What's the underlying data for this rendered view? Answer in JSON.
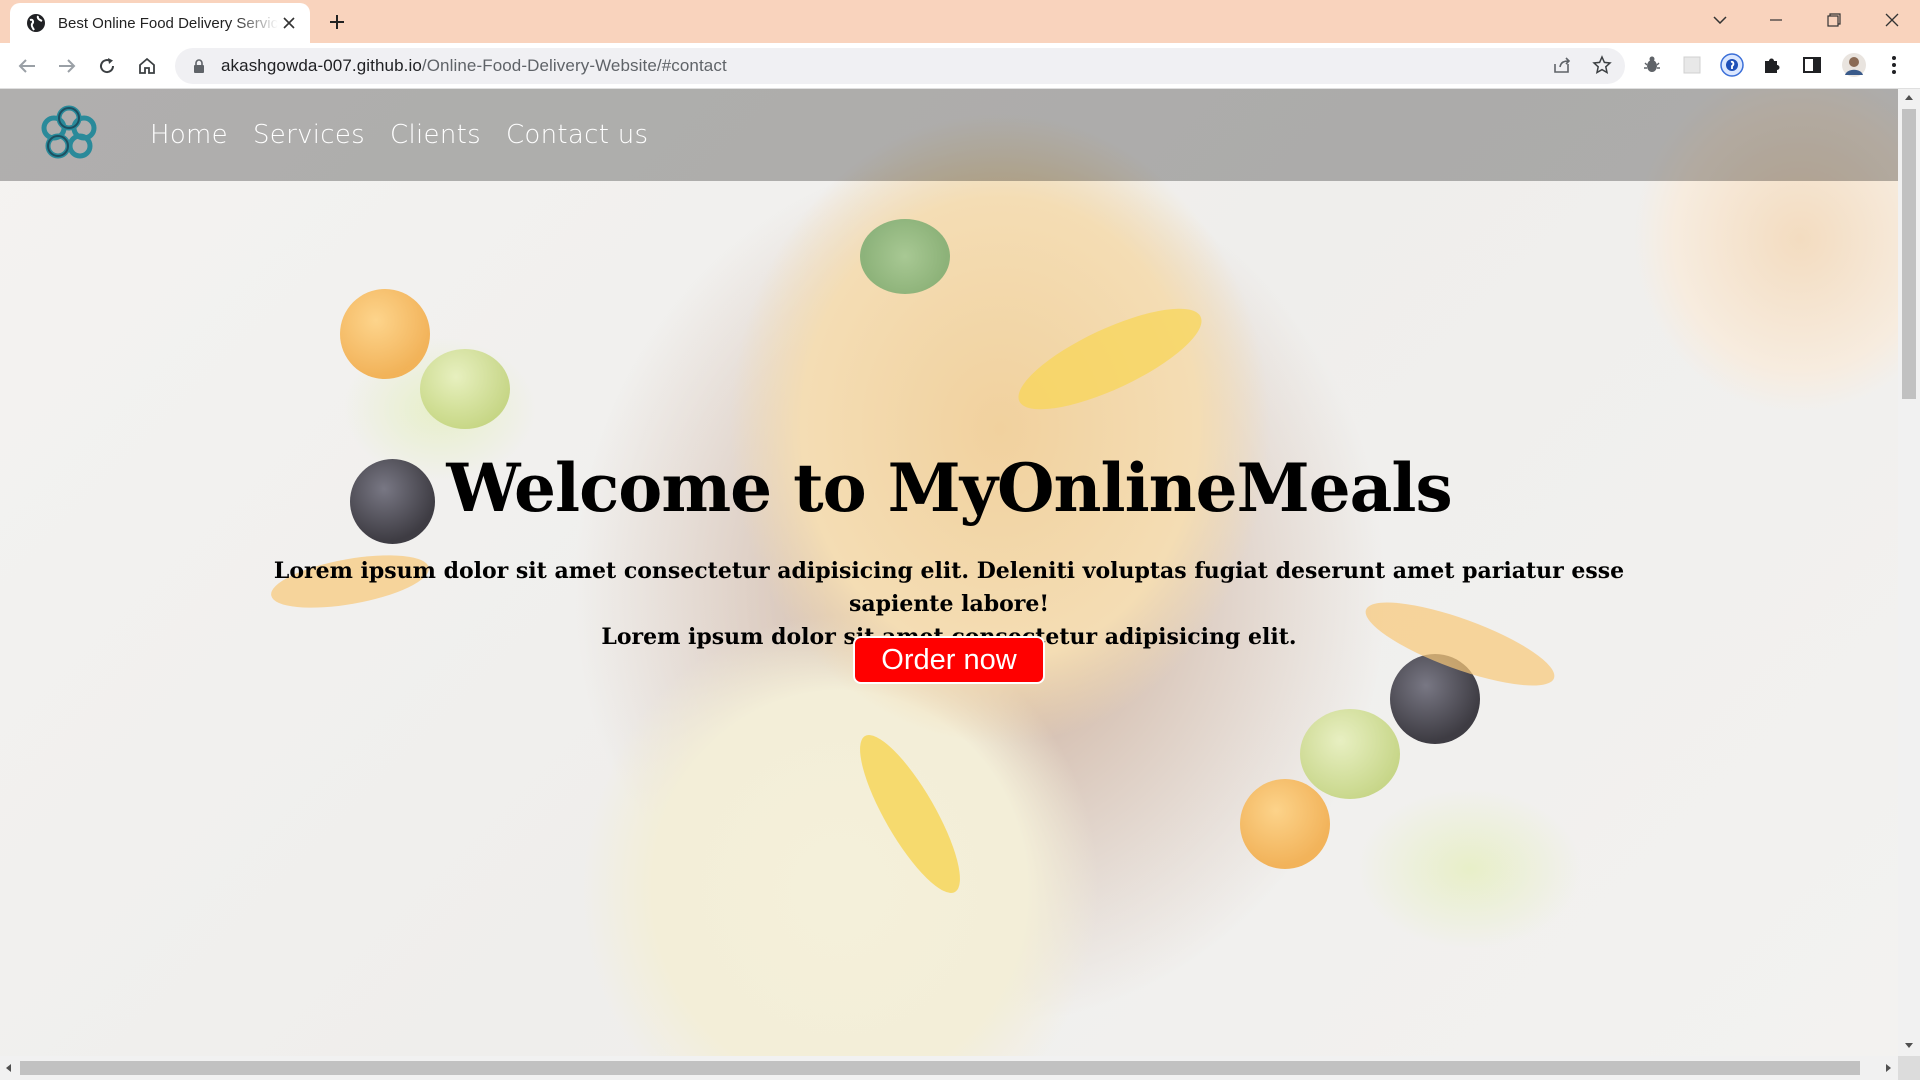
{
  "browser": {
    "tab_title": "Best Online Food Delivery Service",
    "url_host": "akashgowda-007.github.io",
    "url_path": "/Online-Food-Delivery-Website/#contact"
  },
  "nav": {
    "links": [
      "Home",
      "Services",
      "Clients",
      "Contact us"
    ]
  },
  "hero": {
    "title": "Welcome to MyOnlineMeals",
    "text_line1": "Lorem ipsum dolor sit amet consectetur adipisicing elit. Deleniti voluptas fugiat deserunt amet pariatur esse sapiente labore!",
    "text_line2": "Lorem ipsum dolor sit amet consectetur adipisicing elit.",
    "order_button": "Order now"
  },
  "colors": {
    "tabbar": "#f9d3bd",
    "order_button": "#ff0000",
    "logo": "#2a8a9a"
  }
}
